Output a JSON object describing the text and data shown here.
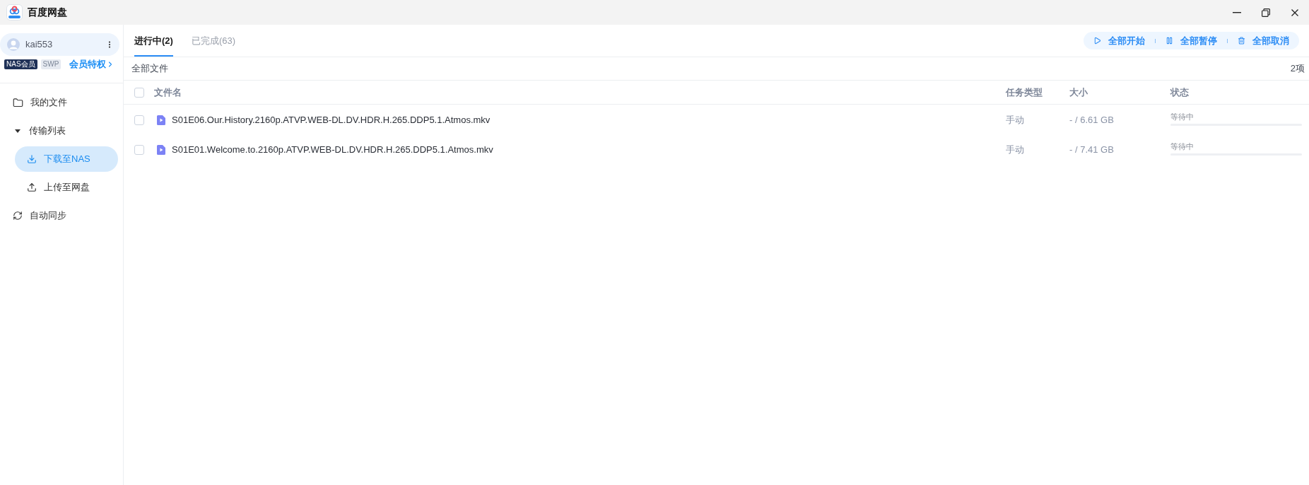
{
  "window": {
    "title": "百度网盘"
  },
  "user": {
    "name": "kai553",
    "badges": [
      {
        "label": "NAS会员",
        "active": true
      },
      {
        "label": "SWP",
        "active": false
      }
    ],
    "perks_link": "会员特权"
  },
  "sidebar": {
    "items": [
      {
        "label": "我的文件",
        "selected": false
      },
      {
        "label": "传输列表",
        "selected": false,
        "expanded": true,
        "children": [
          {
            "label": "下载至NAS",
            "selected": true
          },
          {
            "label": "上传至网盘",
            "selected": false
          }
        ]
      },
      {
        "label": "自动同步",
        "selected": false
      }
    ]
  },
  "tabs": [
    {
      "label": "进行中(2)",
      "selected": true
    },
    {
      "label": "已完成(63)",
      "selected": false
    }
  ],
  "actions": [
    {
      "label": "全部开始"
    },
    {
      "label": "全部暂停"
    },
    {
      "label": "全部取消"
    }
  ],
  "toolbar": {
    "path": "全部文件",
    "count": "2项"
  },
  "table": {
    "select_all": {
      "checked": false
    },
    "columns": [
      "文件名",
      "任务类型",
      "大小",
      "状态"
    ],
    "rows": [
      {
        "checked": false,
        "name": "S01E06.Our.History.2160p.ATVP.WEB-DL.DV.HDR.H.265.DDP5.1.Atmos.mkv",
        "task_type": "手动",
        "size": "- / 6.61 GB",
        "status": "等待中"
      },
      {
        "checked": false,
        "name": "S01E01.Welcome.to.2160p.ATVP.WEB-DL.DV.HDR.H.265.DDP5.1.Atmos.mkv",
        "task_type": "手动",
        "size": "- / 7.41 GB",
        "status": "等待中"
      }
    ]
  }
}
